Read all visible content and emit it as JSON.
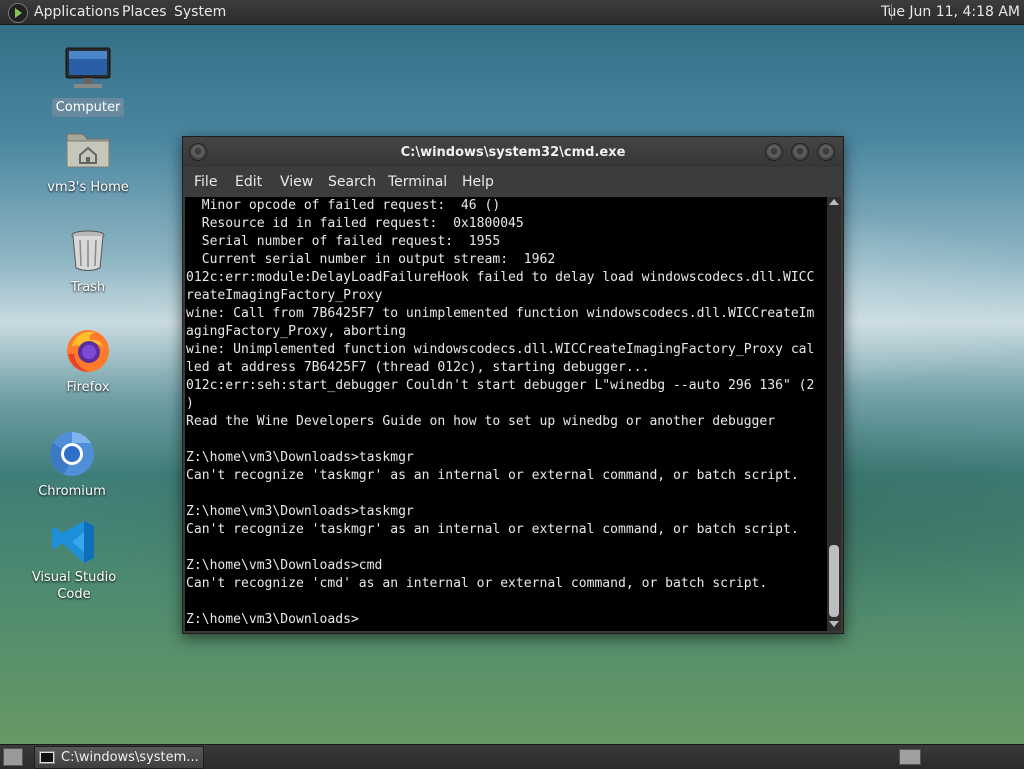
{
  "top_panel": {
    "menus": [
      "Applications",
      "Places",
      "System"
    ],
    "clock": "Tue Jun 11,  4:18 AM"
  },
  "desktop_icons": [
    {
      "label": "Computer",
      "icon": "computer-icon",
      "selected": true
    },
    {
      "label": "vm3's Home",
      "icon": "home-folder-icon"
    },
    {
      "label": "Trash",
      "icon": "trash-icon"
    },
    {
      "label": "Firefox",
      "icon": "firefox-icon"
    },
    {
      "label": "Chromium",
      "icon": "chromium-icon"
    },
    {
      "label": "Visual Studio Code",
      "icon": "vscode-icon"
    }
  ],
  "window": {
    "title": "C:\\windows\\system32\\cmd.exe",
    "menu": [
      "File",
      "Edit",
      "View",
      "Search",
      "Terminal",
      "Help"
    ],
    "lines": [
      "  Minor opcode of failed request:  46 ()",
      "  Resource id in failed request:  0x1800045",
      "  Serial number of failed request:  1955",
      "  Current serial number in output stream:  1962",
      "012c:err:module:DelayLoadFailureHook failed to delay load windowscodecs.dll.WICC",
      "reateImagingFactory_Proxy",
      "wine: Call from 7B6425F7 to unimplemented function windowscodecs.dll.WICCreateIm",
      "agingFactory_Proxy, aborting",
      "wine: Unimplemented function windowscodecs.dll.WICCreateImagingFactory_Proxy cal",
      "led at address 7B6425F7 (thread 012c), starting debugger...",
      "012c:err:seh:start_debugger Couldn't start debugger L\"winedbg --auto 296 136\" (2",
      ")",
      "Read the Wine Developers Guide on how to set up winedbg or another debugger",
      "",
      "Z:\\home\\vm3\\Downloads>taskmgr",
      "Can't recognize 'taskmgr' as an internal or external command, or batch script.",
      "",
      "Z:\\home\\vm3\\Downloads>taskmgr",
      "Can't recognize 'taskmgr' as an internal or external command, or batch script.",
      "",
      "Z:\\home\\vm3\\Downloads>cmd",
      "Can't recognize 'cmd' as an internal or external command, or batch script.",
      "",
      "Z:\\home\\vm3\\Downloads>"
    ]
  },
  "taskbar": {
    "items": [
      {
        "label": "C:\\windows\\system...",
        "icon": "terminal-icon"
      }
    ]
  }
}
